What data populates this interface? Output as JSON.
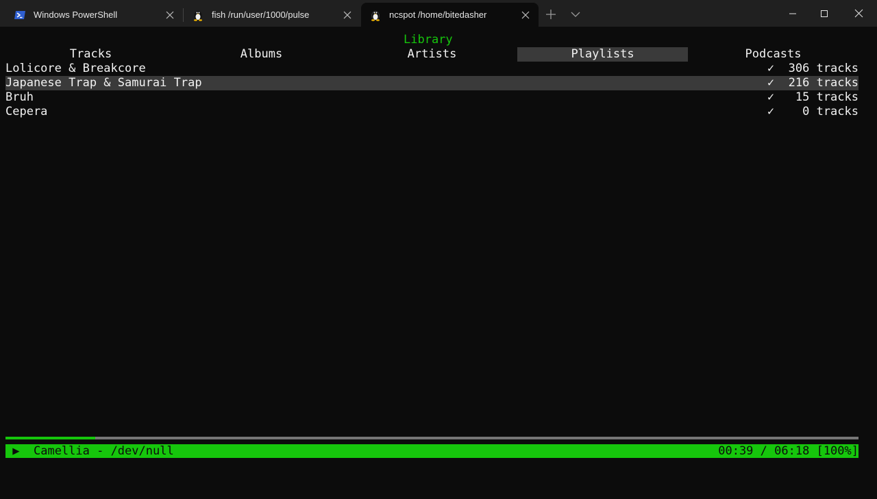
{
  "window": {
    "tabs": [
      {
        "label": "Windows PowerShell",
        "icon": "powershell-icon"
      },
      {
        "label": "fish /run/user/1000/pulse",
        "icon": "linux-penguin-icon"
      },
      {
        "label": "ncspot /home/bitedasher",
        "icon": "linux-penguin-icon",
        "active": true
      }
    ]
  },
  "library": {
    "title": "Library",
    "view_tabs": [
      "Tracks",
      "Albums",
      "Artists",
      "Playlists",
      "Podcasts"
    ],
    "selected_tab": "Playlists",
    "playlists": [
      {
        "name": "Lolicore & Breakcore",
        "saved": "✓",
        "count": "306 tracks"
      },
      {
        "name": "Japanese Trap & Samurai Trap",
        "saved": "✓",
        "count": "216 tracks",
        "selected": true
      },
      {
        "name": "Bruh",
        "saved": "✓",
        "count": "15 tracks"
      },
      {
        "name": "Cepera",
        "saved": "✓",
        "count": "0 tracks"
      }
    ]
  },
  "player": {
    "play_state": "▶",
    "now_playing": "Camellia - /dev/null",
    "elapsed": "00:39",
    "duration": "06:18",
    "volume": "[100%]",
    "progress": 0.105
  },
  "colors": {
    "accent": "#16c60c",
    "selection": "#3a3a3a",
    "background": "#0c0c0c",
    "titlebar": "#202020"
  }
}
